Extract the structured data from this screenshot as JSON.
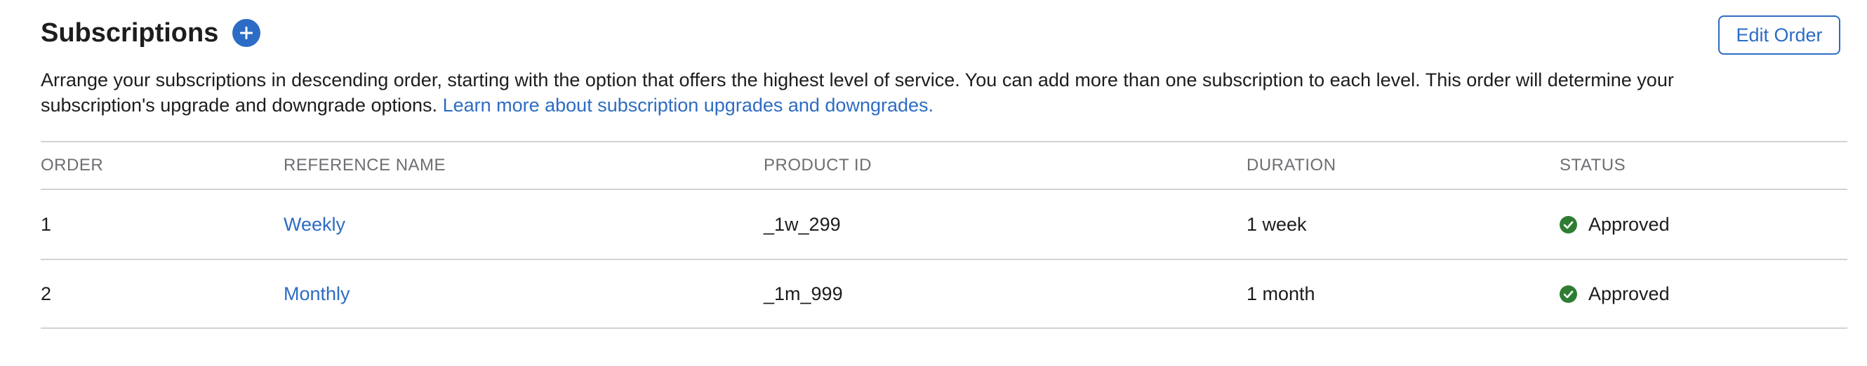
{
  "header": {
    "title": "Subscriptions",
    "edit_order_label": "Edit Order"
  },
  "description": {
    "text": "Arrange your subscriptions in descending order, starting with the option that offers the highest level of service. You can add more than one subscription to each level. This order will determine your subscription's upgrade and downgrade options.",
    "link": "Learn more about subscription upgrades and downgrades."
  },
  "table": {
    "columns": {
      "order": "ORDER",
      "reference_name": "REFERENCE NAME",
      "product_id": "PRODUCT ID",
      "duration": "DURATION",
      "status": "STATUS"
    },
    "rows": [
      {
        "order": "1",
        "reference_name": "Weekly",
        "product_id": "_1w_299",
        "duration": "1 week",
        "status": "Approved"
      },
      {
        "order": "2",
        "reference_name": "Monthly",
        "product_id": "_1m_999",
        "duration": "1 month",
        "status": "Approved"
      }
    ]
  },
  "colors": {
    "accent": "#2d6cc4",
    "approved": "#2e7d32",
    "text": "#1d1d1f",
    "muted": "#6e6e73",
    "divider": "#d2d2d7"
  },
  "icons": {
    "add": "plus-circle-icon",
    "status": "check-circle-icon"
  }
}
